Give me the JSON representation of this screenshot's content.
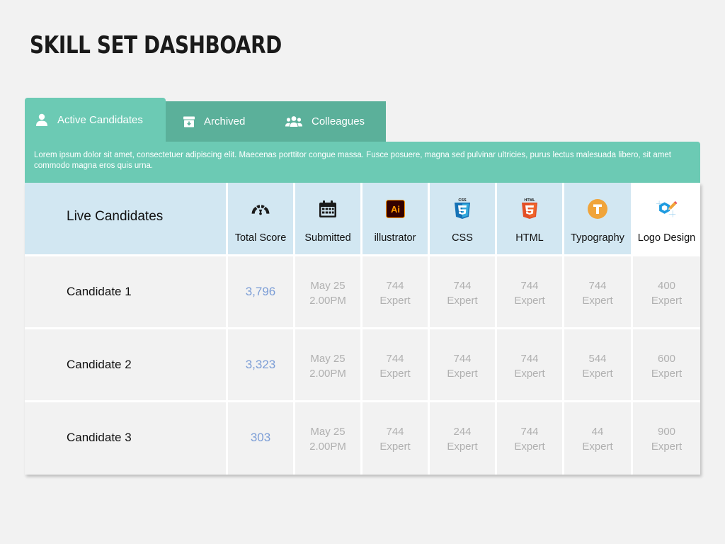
{
  "page": {
    "title": "SKILL SET DASHBOARD"
  },
  "tabs": [
    {
      "label": "Active Candidates",
      "icon": "user-icon",
      "active": true
    },
    {
      "label": "Archived",
      "icon": "archive-box-icon",
      "active": false
    },
    {
      "label": "Colleagues",
      "icon": "users-group-icon",
      "active": false
    }
  ],
  "description": "Lorem ipsum dolor sit amet, consectetuer adipiscing elit. Maecenas porttitor congue massa. Fusce posuere, magna sed pulvinar ultricies, purus lectus malesuada libero, sit amet commodo magna eros quis urna.",
  "table": {
    "title": "Live Candidates",
    "columns": [
      {
        "label": "Total Score",
        "icon": "gauge-icon"
      },
      {
        "label": "Submitted",
        "icon": "calendar-icon"
      },
      {
        "label": "illustrator",
        "icon": "illustrator-icon"
      },
      {
        "label": "CSS",
        "icon": "css3-icon"
      },
      {
        "label": "HTML",
        "icon": "html5-icon"
      },
      {
        "label": "Typography",
        "icon": "typography-icon"
      },
      {
        "label": "Logo Design",
        "icon": "logo-design-icon"
      }
    ],
    "rows": [
      {
        "name": "Candidate  1",
        "score": "3,796",
        "submitted": {
          "date": "May 25",
          "time": "2.00PM"
        },
        "skills": [
          {
            "value": "744",
            "level": "Expert"
          },
          {
            "value": "744",
            "level": "Expert"
          },
          {
            "value": "744",
            "level": "Expert"
          },
          {
            "value": "744",
            "level": "Expert"
          },
          {
            "value": "400",
            "level": "Expert"
          }
        ]
      },
      {
        "name": "Candidate  2",
        "score": "3,323",
        "submitted": {
          "date": "May 25",
          "time": "2.00PM"
        },
        "skills": [
          {
            "value": "744",
            "level": "Expert"
          },
          {
            "value": "744",
            "level": "Expert"
          },
          {
            "value": "744",
            "level": "Expert"
          },
          {
            "value": "544",
            "level": "Expert"
          },
          {
            "value": "600",
            "level": "Expert"
          }
        ]
      },
      {
        "name": "Candidate  3",
        "score": "303",
        "submitted": {
          "date": "May 25",
          "time": "2.00PM"
        },
        "skills": [
          {
            "value": "744",
            "level": "Expert"
          },
          {
            "value": "244",
            "level": "Expert"
          },
          {
            "value": "744",
            "level": "Expert"
          },
          {
            "value": "44",
            "level": "Expert"
          },
          {
            "value": "900",
            "level": "Expert"
          }
        ]
      }
    ]
  },
  "colors": {
    "tab_active": "#6ccab4",
    "tab_inactive": "#5bb09a",
    "header_bg": "#d2e7f2",
    "row_bg": "#f2f2f2",
    "score_text": "#7b9dd6",
    "muted_text": "#b0b0b0"
  }
}
